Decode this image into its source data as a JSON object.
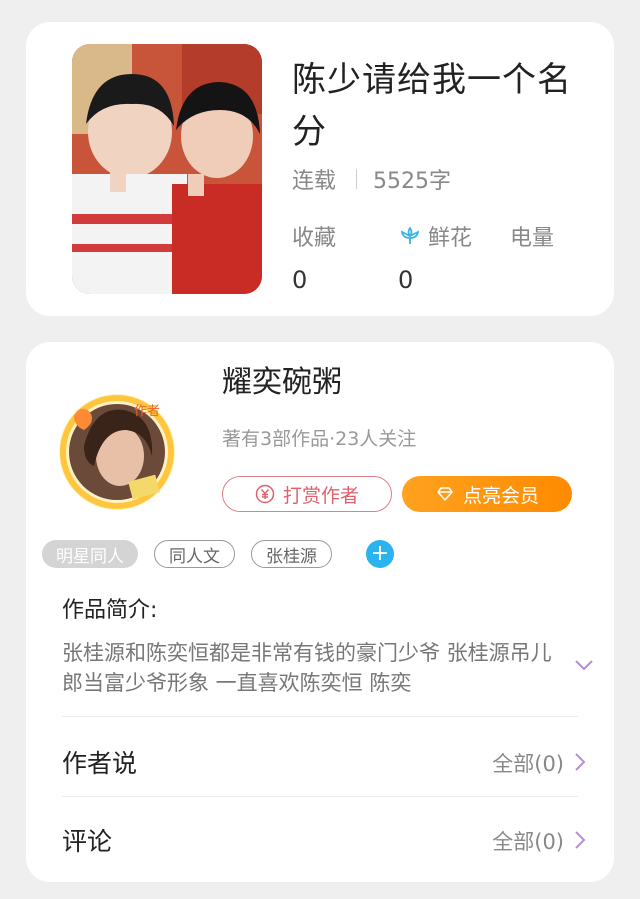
{
  "book": {
    "title": "陈少请给我一个名分",
    "status": "连载",
    "word_count": "5525字",
    "stats": [
      {
        "label": "收藏",
        "value": "0",
        "icon": ""
      },
      {
        "label": "鲜花",
        "value": "0",
        "icon": "flower-icon"
      },
      {
        "label": "电量",
        "value": "",
        "icon": ""
      }
    ]
  },
  "author": {
    "name": "耀奕碗粥",
    "summary": "著有3部作品·23人关注",
    "avatar_badge": "作者",
    "tip_button": "打赏作者",
    "vip_button": "点亮会员"
  },
  "tags": [
    "明星同人",
    "同人文",
    "张桂源"
  ],
  "intro": {
    "label": "作品简介:",
    "text": "张桂源和陈奕恒都是非常有钱的豪门少爷 张桂源吊儿郎当富少爷形象 一直喜欢陈奕恒 陈奕"
  },
  "rows": [
    {
      "label": "作者说",
      "value": "全部(0)"
    },
    {
      "label": "评论",
      "value": "全部(0)"
    }
  ],
  "colors": {
    "tip": "#e0616b",
    "vip": "#ff8a00",
    "tag_add": "#2bb3f0",
    "chevron": "#b48fd6"
  }
}
